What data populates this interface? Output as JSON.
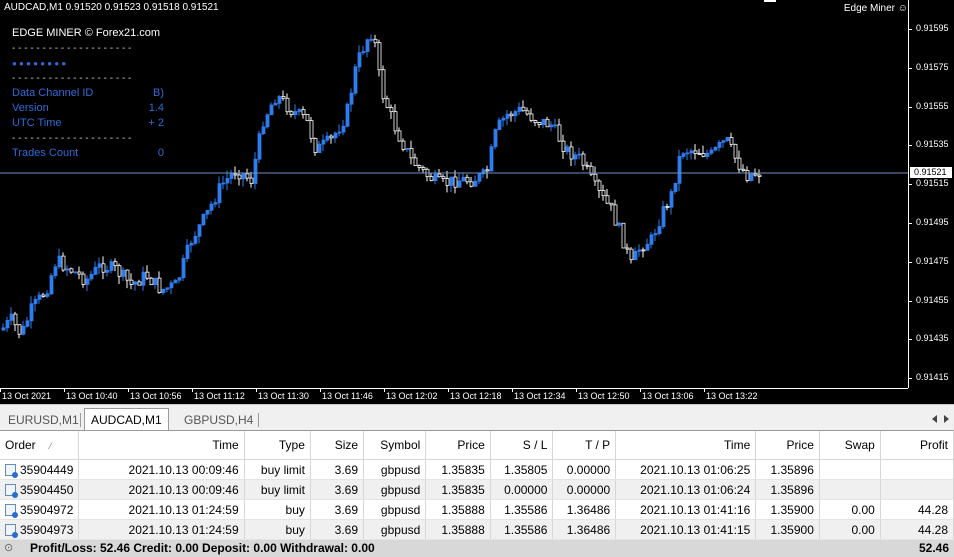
{
  "chart": {
    "title": "AUDCAD,M1  0.91520 0.91523 0.91518 0.91521",
    "brand": "Edge Miner ☺",
    "current_price": "0.91521",
    "price_ticks": [
      "0.91595",
      "0.91575",
      "0.91555",
      "0.91535",
      "0.91515",
      "0.91495",
      "0.91475",
      "0.91455",
      "0.91435",
      "0.91415"
    ],
    "time_ticks": [
      "13 Oct 2021",
      "13 Oct 10:40",
      "13 Oct 10:56",
      "13 Oct 11:12",
      "13 Oct 11:30",
      "13 Oct 11:46",
      "13 Oct 12:02",
      "13 Oct 12:18",
      "13 Oct 12:34",
      "13 Oct 12:50",
      "13 Oct 13:06",
      "13 Oct 13:22"
    ],
    "colors": {
      "bull": "#2f7cf0",
      "bear": "#ffffff",
      "background": "#000000",
      "price_line": "#6c8fc4"
    }
  },
  "panel": {
    "title": "EDGE MINER © Forex21.com",
    "dashes": "- - - - - - - - - - - - - - - - - - - -",
    "dots": "● ● ● ● ● ● ● ●",
    "rows": [
      {
        "label": "Data Channel ID",
        "value": "B)"
      },
      {
        "label": "Version",
        "value": "1.4"
      },
      {
        "label": "UTC Time",
        "value": "+ 2"
      }
    ],
    "trades_label": "Trades Count",
    "trades_value": "0"
  },
  "tabs": [
    "EURUSD,M1",
    "AUDCAD,M1",
    "GBPUSD,H4"
  ],
  "terminal": {
    "headers": [
      "Order",
      "Time",
      "Type",
      "Size",
      "Symbol",
      "Price",
      "S / L",
      "T / P",
      "Time",
      "Price",
      "Swap",
      "Profit"
    ],
    "rows": [
      [
        "35904449",
        "2021.10.13 00:09:46",
        "buy limit",
        "3.69",
        "gbpusd",
        "1.35835",
        "1.35805",
        "0.00000",
        "2021.10.13 01:06:25",
        "1.35896",
        "",
        ""
      ],
      [
        "35904450",
        "2021.10.13 00:09:46",
        "buy limit",
        "3.69",
        "gbpusd",
        "1.35835",
        "0.00000",
        "0.00000",
        "2021.10.13 01:06:24",
        "1.35896",
        "",
        ""
      ],
      [
        "35904972",
        "2021.10.13 01:24:59",
        "buy",
        "3.69",
        "gbpusd",
        "1.35888",
        "1.35586",
        "1.36486",
        "2021.10.13 01:41:16",
        "1.35900",
        "0.00",
        "44.28"
      ],
      [
        "35904973",
        "2021.10.13 01:24:59",
        "buy",
        "3.69",
        "gbpusd",
        "1.35888",
        "1.35586",
        "1.36486",
        "2021.10.13 01:41:15",
        "1.35900",
        "0.00",
        "44.28"
      ]
    ],
    "footer": "Profit/Loss: 52.46  Credit: 0.00  Deposit: 0.00  Withdrawal: 0.00",
    "footer_total": "52.46"
  }
}
